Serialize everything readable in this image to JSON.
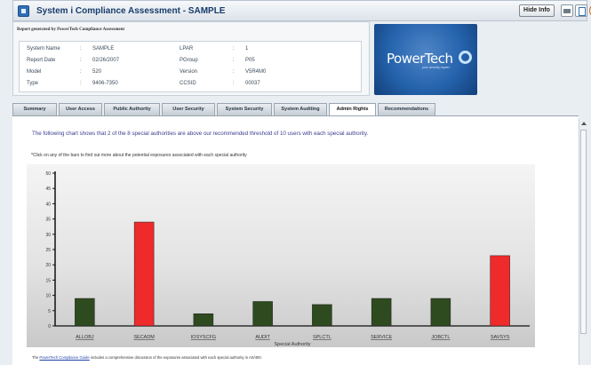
{
  "app": {
    "title": "System i Compliance Assessment - SAMPLE",
    "hide_info_label": "Hide Info",
    "help_glyph": "?"
  },
  "info": {
    "report_note": "Report generated by PowerTech Compliance Assessment",
    "fields": [
      {
        "label": "System Name",
        "sep": ":",
        "value": "SAMPLE"
      },
      {
        "label": "Report Date",
        "sep": ":",
        "value": "02/26/2007"
      },
      {
        "label": "Model",
        "sep": ":",
        "value": "520"
      },
      {
        "label": "Type",
        "sep": ":",
        "value": "9406-7350"
      },
      {
        "label": "LPAR",
        "sep": ":",
        "value": "1"
      },
      {
        "label": "PGroup",
        "sep": ":",
        "value": "P05"
      },
      {
        "label": "Version",
        "sep": ":",
        "value": "V5R4M0"
      },
      {
        "label": "CCSID",
        "sep": ":",
        "value": "00037"
      }
    ]
  },
  "logo": {
    "word": "PowerTech",
    "tagline": "your security expert"
  },
  "tabs": [
    {
      "label": "Summary",
      "active": false
    },
    {
      "label": "User Access",
      "active": false
    },
    {
      "label": "Public Authority",
      "active": false
    },
    {
      "label": "User Security",
      "active": false
    },
    {
      "label": "System Security",
      "active": false
    },
    {
      "label": "System Auditing",
      "active": false
    },
    {
      "label": "Admin Rights",
      "active": true
    },
    {
      "label": "Recommendations",
      "active": false
    }
  ],
  "content": {
    "intro": "The following chart shows that 2 of the 8 special authorities are above our recommended threshold of 10 users with each special authority.",
    "click_note": "*Click on any of the bars to find out more about the potential exposures associated with each special authority",
    "footer_prefix": "The ",
    "footer_link": "PowerTech Compliance Guide",
    "footer_suffix": " includes a comprehensive discussion of the exposures associated with each special authority in AS/400."
  },
  "colors": {
    "normal_bar": "#2e4a1f",
    "exceeds_bar": "#ee2a2a",
    "accent": "#2f6fb7"
  },
  "chart_data": {
    "type": "bar",
    "categories": [
      "ALLOBJ",
      "SECADM",
      "IOSYSCFG",
      "AUDIT",
      "SPLCTL",
      "SERVICE",
      "JOBCTL",
      "SAVSYS"
    ],
    "values": [
      9,
      34,
      4,
      8,
      7,
      9,
      9,
      23
    ],
    "exceeds_threshold": [
      false,
      true,
      false,
      false,
      false,
      false,
      false,
      true
    ],
    "xlabel": "Special Authority",
    "ylabel": "",
    "ylim": [
      0,
      50
    ],
    "yticks": [
      0,
      5,
      10,
      15,
      20,
      25,
      30,
      35,
      40,
      45,
      50
    ],
    "grid": false
  }
}
